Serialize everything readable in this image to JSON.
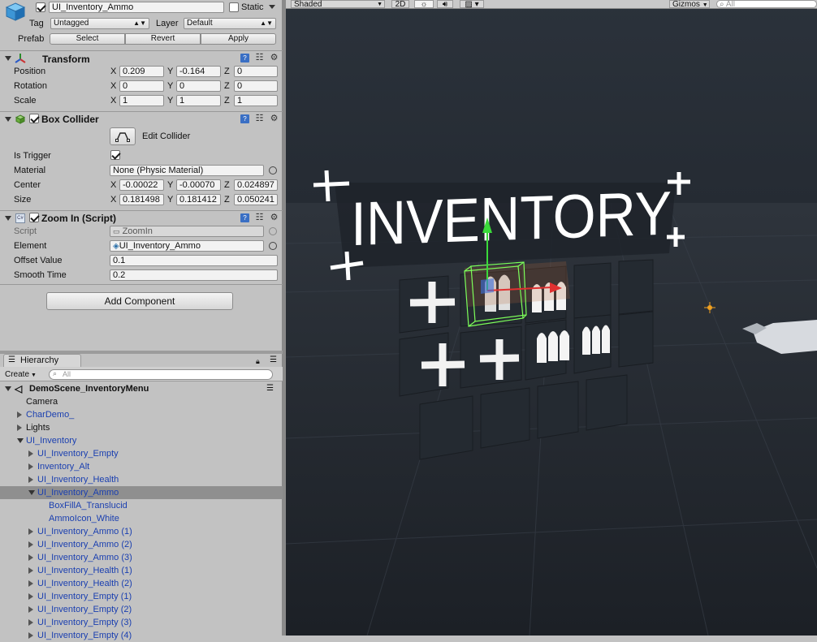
{
  "header": {
    "object_name": "UI_Inventory_Ammo",
    "static_label": "Static",
    "tag_label": "Tag",
    "tag_value": "Untagged",
    "layer_label": "Layer",
    "layer_value": "Default",
    "prefab_label": "Prefab",
    "select_label": "Select",
    "revert_label": "Revert",
    "apply_label": "Apply"
  },
  "transform": {
    "title": "Transform",
    "position_label": "Position",
    "rotation_label": "Rotation",
    "scale_label": "Scale",
    "x": "X",
    "y": "Y",
    "z": "Z",
    "position": [
      "0.209",
      "-0.164",
      "0"
    ],
    "rotation": [
      "0",
      "0",
      "0"
    ],
    "scale": [
      "1",
      "1",
      "1"
    ]
  },
  "box_collider": {
    "title": "Box Collider",
    "edit_label": "Edit Collider",
    "is_trigger_label": "Is Trigger",
    "material_label": "Material",
    "material_value": "None (Physic Material)",
    "center_label": "Center",
    "center": [
      "-0.00022",
      "-0.00070",
      "0.024897"
    ],
    "size_label": "Size",
    "size": [
      "0.181498",
      "0.181412",
      "0.050241"
    ]
  },
  "zoom_in": {
    "title": "Zoom In (Script)",
    "script_label": "Script",
    "script_value": "ZoomIn",
    "element_label": "Element",
    "element_value": "UI_Inventory_Ammo",
    "offset_label": "Offset Value",
    "offset_value": "0.1",
    "smooth_label": "Smooth Time",
    "smooth_value": "0.2"
  },
  "add_component_label": "Add Component",
  "hierarchy": {
    "tab_label": "Hierarchy",
    "create_label": "Create",
    "search_placeholder": "All",
    "scene_name": "DemoScene_InventoryMenu",
    "items": [
      {
        "label": "Camera",
        "depth": 1,
        "arrow": "none",
        "color": "dark",
        "selected": false
      },
      {
        "label": "CharDemo_",
        "depth": 1,
        "arrow": "right",
        "color": "blue",
        "selected": false
      },
      {
        "label": "Lights",
        "depth": 1,
        "arrow": "right",
        "color": "dark",
        "selected": false
      },
      {
        "label": "UI_Inventory",
        "depth": 1,
        "arrow": "down",
        "color": "blue",
        "selected": false
      },
      {
        "label": "UI_Inventory_Empty",
        "depth": 2,
        "arrow": "right",
        "color": "blue",
        "selected": false
      },
      {
        "label": "Inventory_Alt",
        "depth": 2,
        "arrow": "right",
        "color": "blue",
        "selected": false
      },
      {
        "label": "UI_Inventory_Health",
        "depth": 2,
        "arrow": "right",
        "color": "blue",
        "selected": false
      },
      {
        "label": "UI_Inventory_Ammo",
        "depth": 2,
        "arrow": "down",
        "color": "blue",
        "selected": true
      },
      {
        "label": "BoxFillA_Translucid",
        "depth": 3,
        "arrow": "none",
        "color": "blue",
        "selected": false
      },
      {
        "label": "AmmoIcon_White",
        "depth": 3,
        "arrow": "none",
        "color": "blue",
        "selected": false
      },
      {
        "label": "UI_Inventory_Ammo (1)",
        "depth": 2,
        "arrow": "right",
        "color": "blue",
        "selected": false
      },
      {
        "label": "UI_Inventory_Ammo (2)",
        "depth": 2,
        "arrow": "right",
        "color": "blue",
        "selected": false
      },
      {
        "label": "UI_Inventory_Ammo (3)",
        "depth": 2,
        "arrow": "right",
        "color": "blue",
        "selected": false
      },
      {
        "label": "UI_Inventory_Health (1)",
        "depth": 2,
        "arrow": "right",
        "color": "blue",
        "selected": false
      },
      {
        "label": "UI_Inventory_Health (2)",
        "depth": 2,
        "arrow": "right",
        "color": "blue",
        "selected": false
      },
      {
        "label": "UI_Inventory_Empty (1)",
        "depth": 2,
        "arrow": "right",
        "color": "blue",
        "selected": false
      },
      {
        "label": "UI_Inventory_Empty (2)",
        "depth": 2,
        "arrow": "right",
        "color": "blue",
        "selected": false
      },
      {
        "label": "UI_Inventory_Empty (3)",
        "depth": 2,
        "arrow": "right",
        "color": "blue",
        "selected": false
      },
      {
        "label": "UI_Inventory_Empty (4)",
        "depth": 2,
        "arrow": "right",
        "color": "blue",
        "selected": false
      }
    ]
  },
  "scene_view": {
    "shading_mode": "Shaded",
    "mode_2d": "2D",
    "gizmos_label": "Gizmos",
    "search_placeholder": "All",
    "banner_text": "INVENTORY"
  },
  "colors": {
    "panel_bg": "#c2c2c2",
    "selection": "#8f8f8f",
    "object_blue": "#1a3fb0"
  }
}
